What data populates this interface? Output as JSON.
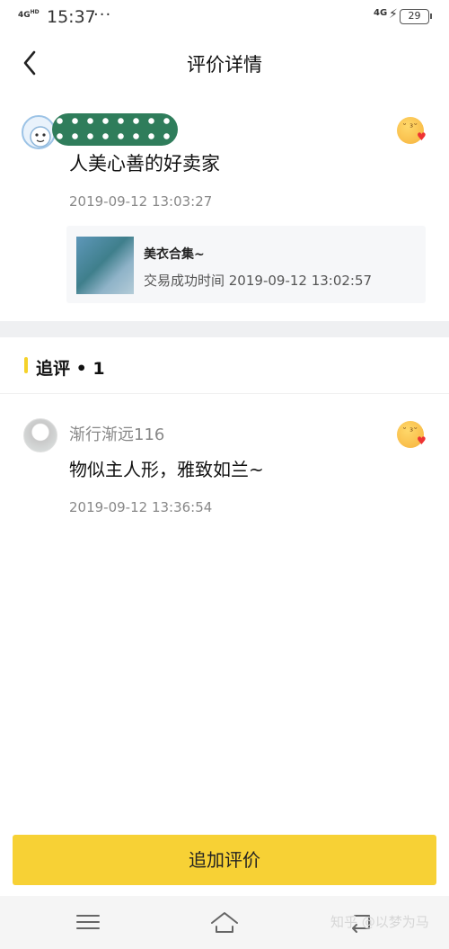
{
  "status_bar": {
    "network": "4G",
    "network_suffix": "HD",
    "time": "15:37",
    "dots": "···",
    "right_network": "4G",
    "battery": "29"
  },
  "header": {
    "title": "评价详情"
  },
  "review": {
    "text": "人美心善的好卖家",
    "time": "2019-09-12 13:03:27",
    "product": {
      "name": "美衣合集~",
      "deal_time": "交易成功时间 2019-09-12 13:02:57"
    }
  },
  "followup": {
    "section_title": "追评 • 1",
    "username": "渐行渐远116",
    "text": "物似主人形，雅致如兰~",
    "time": "2019-09-12 13:36:54"
  },
  "actions": {
    "add_review_label": "追加评价"
  },
  "watermark": "知乎 @以梦为马",
  "colors": {
    "accent_yellow": "#f7d135",
    "section_bar": "#f5d22a",
    "gray_text": "#888888"
  }
}
